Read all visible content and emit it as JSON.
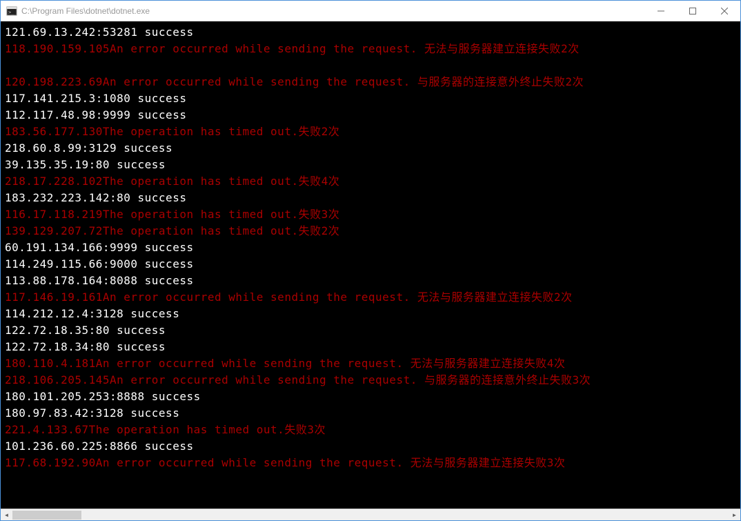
{
  "window": {
    "title": "C:\\Program Files\\dotnet\\dotnet.exe"
  },
  "lines": [
    {
      "type": "success",
      "text": "121.69.13.242:53281 success"
    },
    {
      "type": "error",
      "text": "118.190.159.105An error occurred while sending the request. 无法与服务器建立连接失败2次"
    },
    {
      "type": "error",
      "text": ""
    },
    {
      "type": "error",
      "text": "120.198.223.69An error occurred while sending the request. 与服务器的连接意外终止失败2次"
    },
    {
      "type": "success",
      "text": "117.141.215.3:1080 success"
    },
    {
      "type": "success",
      "text": "112.117.48.98:9999 success"
    },
    {
      "type": "error",
      "text": "183.56.177.130The operation has timed out.失败2次"
    },
    {
      "type": "success",
      "text": "218.60.8.99:3129 success"
    },
    {
      "type": "success",
      "text": "39.135.35.19:80 success"
    },
    {
      "type": "error",
      "text": "218.17.228.102The operation has timed out.失败4次"
    },
    {
      "type": "success",
      "text": "183.232.223.142:80 success"
    },
    {
      "type": "error",
      "text": "116.17.118.219The operation has timed out.失败3次"
    },
    {
      "type": "error",
      "text": "139.129.207.72The operation has timed out.失败2次"
    },
    {
      "type": "success",
      "text": "60.191.134.166:9999 success"
    },
    {
      "type": "success",
      "text": "114.249.115.66:9000 success"
    },
    {
      "type": "success",
      "text": "113.88.178.164:8088 success"
    },
    {
      "type": "error",
      "text": "117.146.19.161An error occurred while sending the request. 无法与服务器建立连接失败2次"
    },
    {
      "type": "success",
      "text": "114.212.12.4:3128 success"
    },
    {
      "type": "success",
      "text": "122.72.18.35:80 success"
    },
    {
      "type": "success",
      "text": "122.72.18.34:80 success"
    },
    {
      "type": "error",
      "text": "180.110.4.181An error occurred while sending the request. 无法与服务器建立连接失败4次"
    },
    {
      "type": "error",
      "text": "218.106.205.145An error occurred while sending the request. 与服务器的连接意外终止失败3次"
    },
    {
      "type": "success",
      "text": "180.101.205.253:8888 success"
    },
    {
      "type": "success",
      "text": "180.97.83.42:3128 success"
    },
    {
      "type": "error",
      "text": "221.4.133.67The operation has timed out.失败3次"
    },
    {
      "type": "success",
      "text": "101.236.60.225:8866 success"
    },
    {
      "type": "error",
      "text": "117.68.192.90An error occurred while sending the request. 无法与服务器建立连接失败3次"
    }
  ]
}
